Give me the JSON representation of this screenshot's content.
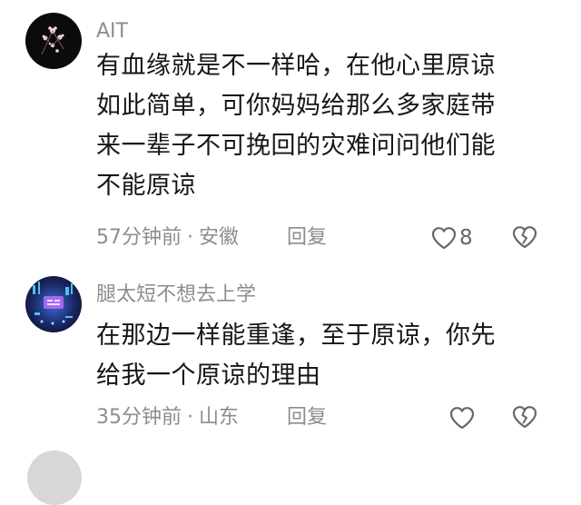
{
  "comments": [
    {
      "username": "AIT",
      "text_lines": [
        "有血缘就是不一样哈，在他心里原谅",
        "如此简单，可你妈妈给那么多家庭带",
        "来一辈子不可挽回的灾难问问他们能",
        "不能原谅"
      ],
      "time": "57分钟前",
      "separator": "·",
      "location": "安徽",
      "reply_label": "回复",
      "likes": "8"
    },
    {
      "username": "腿太短不想去上学",
      "text_lines": [
        "在那边一样能重逢，至于原谅，你先",
        "给我一个原谅的理由"
      ],
      "time": "35分钟前",
      "separator": "·",
      "location": "山东",
      "reply_label": "回复",
      "likes": ""
    }
  ],
  "icons": {
    "like": "heart-outline-icon",
    "dislike": "broken-heart-icon"
  },
  "colors": {
    "text": "#161616",
    "meta": "#8d8d8d",
    "icon": "#666666"
  }
}
